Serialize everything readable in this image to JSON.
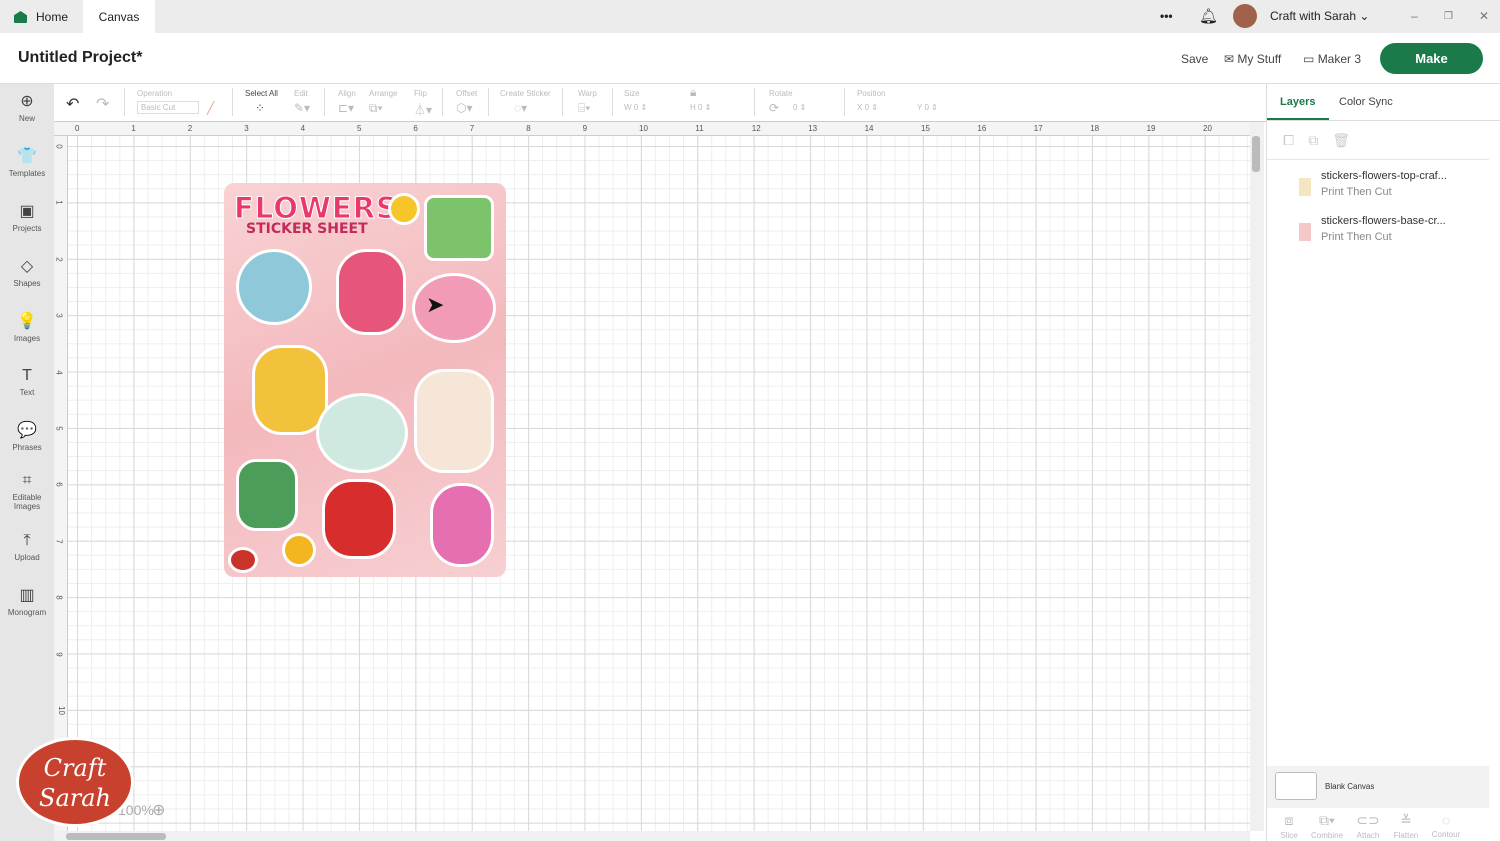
{
  "tabs": {
    "home": "Home",
    "canvas": "Canvas"
  },
  "topbar": {
    "more": "•••",
    "user": "Craft with Sarah",
    "minimize": "–",
    "restore": "❐",
    "close": "✕"
  },
  "header": {
    "title": "Untitled Project*",
    "save": "Save",
    "my_stuff": "My Stuff",
    "machine": "Maker 3",
    "make": "Make"
  },
  "sidebar": [
    {
      "label": "New",
      "icon": "⊕"
    },
    {
      "label": "Templates",
      "icon": "👕"
    },
    {
      "label": "Projects",
      "icon": "▣"
    },
    {
      "label": "Shapes",
      "icon": "◇"
    },
    {
      "label": "Images",
      "icon": "💡"
    },
    {
      "label": "Text",
      "icon": "T"
    },
    {
      "label": "Phrases",
      "icon": "💬"
    },
    {
      "label": "Editable Images",
      "icon": "⌗"
    },
    {
      "label": "Upload",
      "icon": "⤒"
    },
    {
      "label": "Monogram",
      "icon": "▥"
    }
  ],
  "toolbar": {
    "operation": "Operation",
    "operation_value": "Basic Cut",
    "select_all": "Select All",
    "edit": "Edit",
    "align": "Align",
    "arrange": "Arrange",
    "flip": "Flip",
    "offset": "Offset",
    "create_sticker": "Create Sticker",
    "warp": "Warp",
    "size": "Size",
    "w": "W",
    "h": "H",
    "rotate": "Rotate",
    "position": "Position",
    "x": "X",
    "y": "Y",
    "zero": "0"
  },
  "ruler": {
    "top": [
      "0",
      "1",
      "2",
      "3",
      "4",
      "5",
      "6",
      "7",
      "8",
      "9",
      "10",
      "11",
      "12",
      "13",
      "14",
      "15",
      "16",
      "17",
      "18",
      "19",
      "20"
    ],
    "left": [
      "0",
      "1",
      "2",
      "3",
      "4",
      "5",
      "6",
      "7",
      "8",
      "9",
      "10"
    ]
  },
  "sheet": {
    "title": "FLOWERS",
    "subtitle": "STICKER SHEET"
  },
  "zoom": "100%",
  "logo": "Craft with Sarah",
  "panel": {
    "tabs": [
      "Layers",
      "Color Sync"
    ],
    "layers": [
      {
        "name": "stickers-flowers-top-craf...",
        "type": "Print Then Cut"
      },
      {
        "name": "stickers-flowers-base-cr...",
        "type": "Print Then Cut"
      }
    ],
    "blank": "Blank Canvas",
    "tools": [
      "Slice",
      "Combine",
      "Attach",
      "Flatten",
      "Contour"
    ]
  },
  "colors": {
    "accent": "#1b7a4a"
  }
}
